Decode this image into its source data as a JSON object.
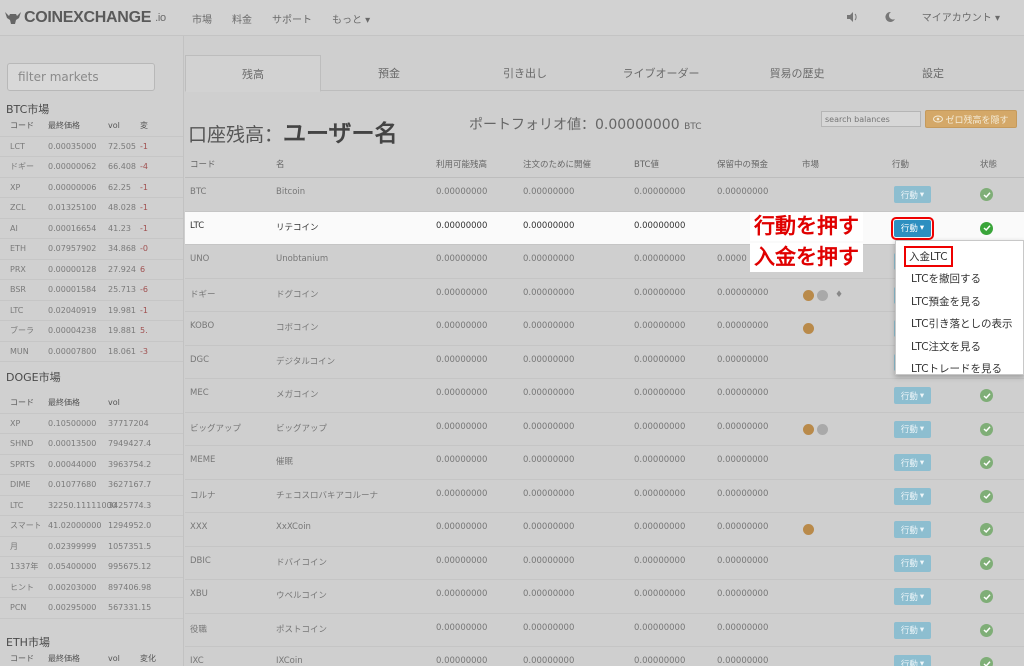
{
  "logo": {
    "brand": "COINEXCHANGE",
    "suffix": ".io"
  },
  "nav": [
    "市場",
    "料金",
    "サポート",
    "もっと ▾"
  ],
  "account_menu": "マイアカウント ▾",
  "sidebar": {
    "filter_placeholder": "filter markets",
    "btc_title": "BTC市場",
    "btc_head": [
      "コード",
      "最終価格",
      "vol",
      "変"
    ],
    "btc_rows": [
      [
        "LCT",
        "0.00035000",
        "72.505",
        "-1"
      ],
      [
        "ドギー",
        "0.00000062",
        "66.408",
        "-4"
      ],
      [
        "XP",
        "0.00000006",
        "62.25",
        "-1"
      ],
      [
        "ZCL",
        "0.01325100",
        "48.028",
        "-1"
      ],
      [
        "AI",
        "0.00016654",
        "41.23",
        "-1"
      ],
      [
        "ETH",
        "0.07957902",
        "34.868",
        "-0"
      ],
      [
        "PRX",
        "0.00000128",
        "27.924",
        "6"
      ],
      [
        "BSR",
        "0.00001584",
        "25.713",
        "-6"
      ],
      [
        "LTC",
        "0.02040919",
        "19.981",
        "-1"
      ],
      [
        "ブーラ",
        "0.00004238",
        "19.881",
        "5."
      ],
      [
        "MUN",
        "0.00007800",
        "18.061",
        "-3"
      ]
    ],
    "doge_title": "DOGE市場",
    "doge_head": [
      "コード",
      "最終価格",
      "vol",
      ""
    ],
    "doge_rows": [
      [
        "XP",
        "0.10500000",
        "37717204",
        ""
      ],
      [
        "SHND",
        "0.00013500",
        "7949427.4",
        ""
      ],
      [
        "SPRTS",
        "0.00044000",
        "3963754.2",
        ""
      ],
      [
        "DIME",
        "0.01077680",
        "3627167.7",
        ""
      ],
      [
        "LTC",
        "32250.11111000",
        "3425774.3",
        ""
      ],
      [
        "スマート",
        "41.02000000",
        "1294952.0",
        ""
      ],
      [
        "月",
        "0.02399999",
        "1057351.5",
        ""
      ],
      [
        "1337年",
        "0.05400000",
        "995675.12",
        ""
      ],
      [
        "ヒント",
        "0.00203000",
        "897406.98",
        ""
      ],
      [
        "PCN",
        "0.00295000",
        "567331.15",
        ""
      ]
    ],
    "eth_title": "ETH市場",
    "eth_head": [
      "コード",
      "最終価格",
      "vol",
      "変化"
    ]
  },
  "tabs": [
    "残高",
    "預金",
    "引き出し",
    "ライブオーダー",
    "貿易の歴史",
    "設定"
  ],
  "title": {
    "label": "口座残高：",
    "user": "ユーザー名"
  },
  "portfolio": {
    "label": "ポートフォリオ値：0.00000000",
    "unit": "BTC"
  },
  "search_placeholder": "search balances",
  "hide_zero": "ゼロ残高を隠す",
  "table_head": [
    "コード",
    "名",
    "利用可能残高",
    "注文のために開催",
    "BTC値",
    "保留中の預金",
    "市場",
    "行動",
    "状態"
  ],
  "action_label": "行動",
  "rows": [
    {
      "code": "BTC",
      "name": "Bitcoin",
      "avail": "0.00000000",
      "held": "0.00000000",
      "btc": "0.00000000",
      "pending": "0.00000000"
    },
    {
      "code": "LTC",
      "name": "リテコイン",
      "avail": "0.00000000",
      "held": "0.00000000",
      "btc": "0.00000000",
      "pending": ""
    },
    {
      "code": "UNO",
      "name": "Unobtanium",
      "avail": "0.00000000",
      "held": "0.00000000",
      "btc": "0.00000000",
      "pending": "0.0000"
    },
    {
      "code": "ドギー",
      "name": "ドグコイン",
      "avail": "0.00000000",
      "held": "0.00000000",
      "btc": "0.00000000",
      "pending": "0.00000000"
    },
    {
      "code": "KOBO",
      "name": "コボコイン",
      "avail": "0.00000000",
      "held": "0.00000000",
      "btc": "0.00000000",
      "pending": "0.00000000"
    },
    {
      "code": "DGC",
      "name": "デジタルコイン",
      "avail": "0.00000000",
      "held": "0.00000000",
      "btc": "0.00000000",
      "pending": "0.00000000"
    },
    {
      "code": "MEC",
      "name": "メガコイン",
      "avail": "0.00000000",
      "held": "0.00000000",
      "btc": "0.00000000",
      "pending": "0.00000000"
    },
    {
      "code": "ビッグアップ",
      "name": "ビッグアップ",
      "avail": "0.00000000",
      "held": "0.00000000",
      "btc": "0.00000000",
      "pending": "0.00000000"
    },
    {
      "code": "MEME",
      "name": "催眠",
      "avail": "0.00000000",
      "held": "0.00000000",
      "btc": "0.00000000",
      "pending": "0.00000000"
    },
    {
      "code": "コルナ",
      "name": "チェコスロバキアコルーナ",
      "avail": "0.00000000",
      "held": "0.00000000",
      "btc": "0.00000000",
      "pending": "0.00000000"
    },
    {
      "code": "XXX",
      "name": "XxXCoin",
      "avail": "0.00000000",
      "held": "0.00000000",
      "btc": "0.00000000",
      "pending": "0.00000000"
    },
    {
      "code": "DBIC",
      "name": "ドバイコイン",
      "avail": "0.00000000",
      "held": "0.00000000",
      "btc": "0.00000000",
      "pending": "0.00000000"
    },
    {
      "code": "XBU",
      "name": "ウベルコイン",
      "avail": "0.00000000",
      "held": "0.00000000",
      "btc": "0.00000000",
      "pending": "0.00000000"
    },
    {
      "code": "役職",
      "name": "ポストコイン",
      "avail": "0.00000000",
      "held": "0.00000000",
      "btc": "0.00000000",
      "pending": "0.00000000"
    },
    {
      "code": "IXC",
      "name": "IXCoin",
      "avail": "0.00000000",
      "held": "0.00000000",
      "btc": "0.00000000",
      "pending": "0.00000000"
    }
  ],
  "annotations": {
    "press_action": "行動を押す",
    "press_deposit": "入金を押す"
  },
  "dropdown": [
    "入金LTC",
    "LTCを撤回する",
    "LTC預金を見る",
    "LTC引き落としの表示",
    "LTC注文を見る",
    "LTCトレードを見る"
  ],
  "colors": {
    "accent": "#2d8fc0",
    "annotation": "#e00000",
    "ok": "#3aa53a",
    "warn_button": "#d4a868"
  }
}
